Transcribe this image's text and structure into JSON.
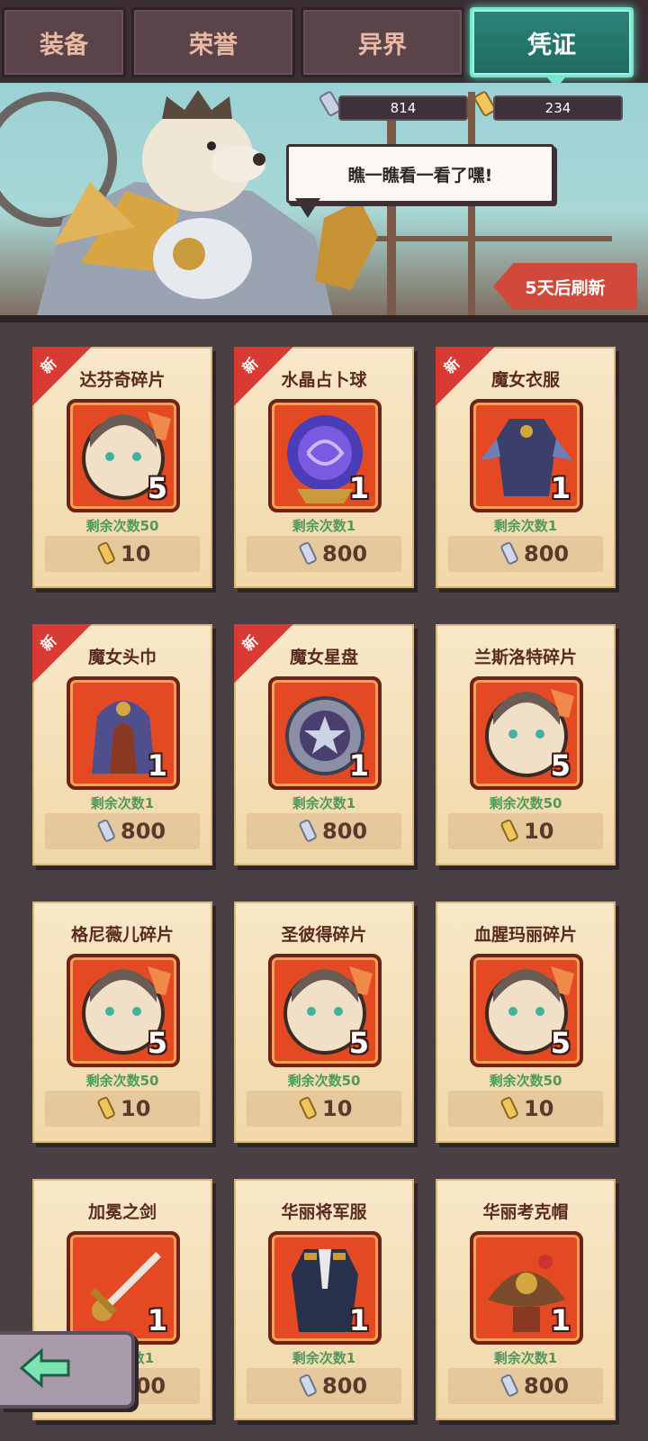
{
  "tabs": [
    {
      "label": "装备",
      "active": false
    },
    {
      "label": "荣誉",
      "active": false
    },
    {
      "label": "异界",
      "active": false
    },
    {
      "label": "凭证",
      "active": true
    }
  ],
  "currencies": [
    {
      "icon": "silver-scroll-icon",
      "value": "814"
    },
    {
      "icon": "gold-scroll-icon",
      "value": "234"
    }
  ],
  "speech": "瞧一瞧看一看了嘿!",
  "refresh_label": "5天后刷新",
  "new_tag": "新",
  "items": [
    {
      "name": "达芬奇碎片",
      "qty": "5",
      "remain": "剩余次数50",
      "price": "10",
      "currency": "gold",
      "is_new": true,
      "art": "hero-fragment"
    },
    {
      "name": "水晶占卜球",
      "qty": "1",
      "remain": "剩余次数1",
      "price": "800",
      "currency": "silver",
      "is_new": true,
      "art": "crystal-ball"
    },
    {
      "name": "魔女衣服",
      "qty": "1",
      "remain": "剩余次数1",
      "price": "800",
      "currency": "silver",
      "is_new": true,
      "art": "robe"
    },
    {
      "name": "魔女头巾",
      "qty": "1",
      "remain": "剩余次数1",
      "price": "800",
      "currency": "silver",
      "is_new": true,
      "art": "hood"
    },
    {
      "name": "魔女星盘",
      "qty": "1",
      "remain": "剩余次数1",
      "price": "800",
      "currency": "silver",
      "is_new": true,
      "art": "astrolabe"
    },
    {
      "name": "兰斯洛特碎片",
      "qty": "5",
      "remain": "剩余次数50",
      "price": "10",
      "currency": "gold",
      "is_new": false,
      "art": "hero-fragment"
    },
    {
      "name": "格尼薇儿碎片",
      "qty": "5",
      "remain": "剩余次数50",
      "price": "10",
      "currency": "gold",
      "is_new": false,
      "art": "hero-fragment"
    },
    {
      "name": "圣彼得碎片",
      "qty": "5",
      "remain": "剩余次数50",
      "price": "10",
      "currency": "gold",
      "is_new": false,
      "art": "hero-fragment"
    },
    {
      "name": "血腥玛丽碎片",
      "qty": "5",
      "remain": "剩余次数50",
      "price": "10",
      "currency": "gold",
      "is_new": false,
      "art": "hero-fragment"
    },
    {
      "name": "加冕之剑",
      "qty": "1",
      "remain": "剩余次数1",
      "price": "800",
      "currency": "silver",
      "is_new": false,
      "art": "sword"
    },
    {
      "name": "华丽将军服",
      "qty": "1",
      "remain": "剩余次数1",
      "price": "800",
      "currency": "silver",
      "is_new": false,
      "art": "uniform"
    },
    {
      "name": "华丽考克帽",
      "qty": "1",
      "remain": "剩余次数1",
      "price": "800",
      "currency": "silver",
      "is_new": false,
      "art": "hat"
    }
  ],
  "colors": {
    "active_tab": "#2c8378",
    "item_frame": "#e34a24",
    "remain_text": "#4e9a5a",
    "new_tag": "#d93a33"
  }
}
